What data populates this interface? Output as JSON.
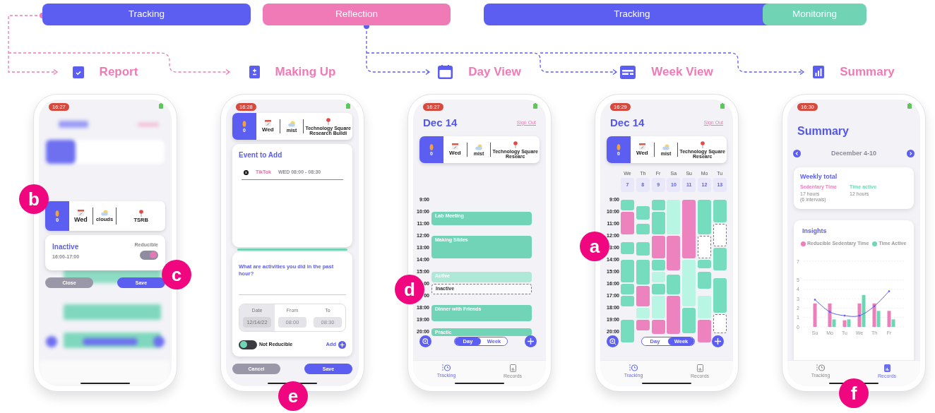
{
  "stages": [
    {
      "label": "Tracking",
      "color": "#5b5ef0"
    },
    {
      "label": "Reflection",
      "color": "#f07ab5"
    },
    {
      "label": "Tracking",
      "color": "#5b5ef0"
    },
    {
      "label": "Monitoring",
      "color": "#6fd3b4"
    }
  ],
  "sections": [
    {
      "kind": "report",
      "title": "Report"
    },
    {
      "kind": "making_up",
      "title": "Making Up"
    },
    {
      "kind": "day",
      "title": "Day View"
    },
    {
      "kind": "week",
      "title": "Week View"
    },
    {
      "kind": "summary",
      "title": "Summary"
    }
  ],
  "phones": [
    {
      "kind": "report",
      "time": "16:27",
      "strip": {
        "steps": "0",
        "day": "Wed",
        "weather": "clouds",
        "location": "TSRB"
      },
      "card": {
        "title": "Inactive",
        "hours": "16:00-17:00",
        "switch_label": "Reducible",
        "on": true
      },
      "buttons": [
        "Close",
        "Save"
      ],
      "annotations": [
        "b",
        "c"
      ]
    },
    {
      "kind": "making_up",
      "time": "16:28",
      "strip": {
        "steps": "0",
        "day": "Wed",
        "weather": "mist",
        "location": "Technology Square Research Buildi"
      },
      "event_card": {
        "title": "Event to Add",
        "entries": [
          {
            "app": "TikTok",
            "when": "WED 08:00 - 08:30"
          }
        ]
      },
      "question": "What are activities you did in the past hour?",
      "fields": [
        {
          "label": "Date",
          "value": "12/14/22",
          "selected": true
        },
        {
          "label": "From",
          "value": "08:00",
          "selected": false
        },
        {
          "label": "To",
          "value": "08:30",
          "selected": false
        }
      ],
      "switch": {
        "label": "Not Reducible",
        "on": false
      },
      "add": "Add",
      "buttons": [
        "Cancel",
        "Save"
      ],
      "annotations": [
        "e"
      ]
    },
    {
      "kind": "day",
      "time": "16:27",
      "title": "Dec 14",
      "sign_out": "Sign Out",
      "strip": {
        "steps": "0",
        "day": "Wed",
        "weather": "mist",
        "location": "Technology Square Researc"
      },
      "hours": [
        "9:00",
        "10:00",
        "11:00",
        "12:00",
        "13:00",
        "14:00",
        "15:00",
        "00",
        "00",
        "18:00",
        "19:00",
        "20:00"
      ],
      "events": [
        {
          "label": "Lab Meeting",
          "kind": "active"
        },
        {
          "label": "Making Slides",
          "kind": "active"
        },
        {
          "label": "Active",
          "kind": "pale"
        },
        {
          "label": "Inactive",
          "kind": "empty"
        },
        {
          "label": "Dinner with Friends",
          "kind": "active"
        },
        {
          "label": "Practic",
          "kind": "active"
        }
      ],
      "toggle": [
        {
          "label": "Day",
          "selected": true
        },
        {
          "label": "Week",
          "selected": false
        }
      ],
      "tabs": [
        {
          "label": "Tracking",
          "selected": true
        },
        {
          "label": "Records",
          "selected": false
        }
      ],
      "annotations": [
        "d"
      ]
    },
    {
      "kind": "week",
      "time": "16:29",
      "title": "Dec 14",
      "sign_out": "Sign Out",
      "strip": {
        "steps": "0",
        "day": "Wed",
        "weather": "mist",
        "location": "Technology Square Researc"
      },
      "hours": [
        "9:00",
        "10:00",
        "11:00",
        "12:00",
        "3:00",
        "14:00",
        "15:00",
        "16:00",
        "17:00",
        "18:00",
        "19:00",
        "20:00"
      ],
      "days": [
        {
          "day": "We",
          "date": "7",
          "blocks": [
            {
              "kind": "active"
            },
            {
              "kind": "reducible"
            },
            {
              "kind": "active"
            },
            {
              "kind": "active"
            },
            {
              "kind": "active"
            },
            {
              "kind": "active"
            },
            {
              "kind": "active"
            }
          ]
        },
        {
          "day": "Th",
          "date": "8",
          "blocks": [
            {
              "kind": "active"
            },
            {
              "kind": "active"
            },
            {
              "kind": "active"
            },
            {
              "kind": "active"
            },
            {
              "kind": "reducible"
            },
            {
              "kind": "pale"
            },
            {
              "kind": "reducible"
            }
          ]
        },
        {
          "day": "Fr",
          "date": "9",
          "blocks": [
            {
              "kind": "active"
            },
            {
              "kind": "active"
            },
            {
              "kind": "reducible"
            },
            {
              "kind": "active"
            },
            {
              "kind": "pale"
            },
            {
              "kind": "active"
            },
            {
              "kind": "pale"
            },
            {
              "kind": "reducible"
            }
          ]
        },
        {
          "day": "Sa",
          "date": "10",
          "blocks": [
            {
              "kind": "pale"
            },
            {
              "kind": "reducible"
            },
            {
              "kind": "active"
            },
            {
              "kind": "reducible"
            }
          ]
        },
        {
          "day": "Su",
          "date": "11",
          "blocks": [
            {
              "kind": "reducible"
            },
            {
              "kind": "pale"
            },
            {
              "kind": "active"
            }
          ]
        },
        {
          "day": "Mo",
          "date": "12",
          "blocks": [
            {
              "kind": "active"
            },
            {
              "kind": "empty"
            },
            {
              "kind": "active"
            },
            {
              "kind": "active"
            },
            {
              "kind": "pale"
            },
            {
              "kind": "reducible"
            }
          ]
        },
        {
          "day": "Tu",
          "date": "13",
          "blocks": [
            {
              "kind": "active"
            },
            {
              "kind": "empty"
            },
            {
              "kind": "active"
            },
            {
              "kind": "active"
            },
            {
              "kind": "empty"
            }
          ]
        }
      ],
      "toggle": [
        {
          "label": "Day",
          "selected": false
        },
        {
          "label": "Week",
          "selected": true
        }
      ],
      "tabs": [
        {
          "label": "Tracking",
          "selected": true
        },
        {
          "label": "Records",
          "selected": false
        }
      ],
      "annotations": [
        "a"
      ]
    },
    {
      "kind": "summary",
      "time": "16:30",
      "title": "Summary",
      "range": "December 4-10",
      "weekly": {
        "title": "Weekly total",
        "items": [
          {
            "label": "Sedentary Time",
            "lines": [
              "17 hours",
              "(6 intervals)"
            ],
            "color": "#ec7fba"
          },
          {
            "label": "Time active",
            "lines": [
              "12 hours"
            ],
            "color": "#6fd6b4"
          }
        ]
      },
      "insights": {
        "title": "Insights",
        "chart_data": {
          "type": "bar",
          "grid": true,
          "categories": [
            "Su",
            "Mo",
            "Tu",
            "We",
            "Th",
            "Fr"
          ],
          "ylim": [
            0,
            7
          ],
          "yticks": [
            0,
            1,
            2,
            3,
            4,
            5,
            7
          ],
          "series": [
            {
              "name": "Reducible Sedentary Time",
              "color": "#ec7fba",
              "values": [
                2.5,
                2.5,
                0.7,
                2.5,
                2.5,
                1.7
              ]
            },
            {
              "name": "Time Active",
              "color": "#6fd6b4",
              "values": [
                null,
                0.8,
                0.8,
                3.4,
                1.7,
                0.8
              ]
            },
            {
              "type": "line",
              "color": "#5b5ef0",
              "values": [
                2.9,
                1.6,
                1.2,
                1.2,
                2.2,
                3.8
              ]
            }
          ]
        }
      },
      "tabs": [
        {
          "label": "Tracking",
          "selected": false
        },
        {
          "label": "Records",
          "selected": true
        }
      ],
      "annotations": [
        "f"
      ]
    }
  ]
}
